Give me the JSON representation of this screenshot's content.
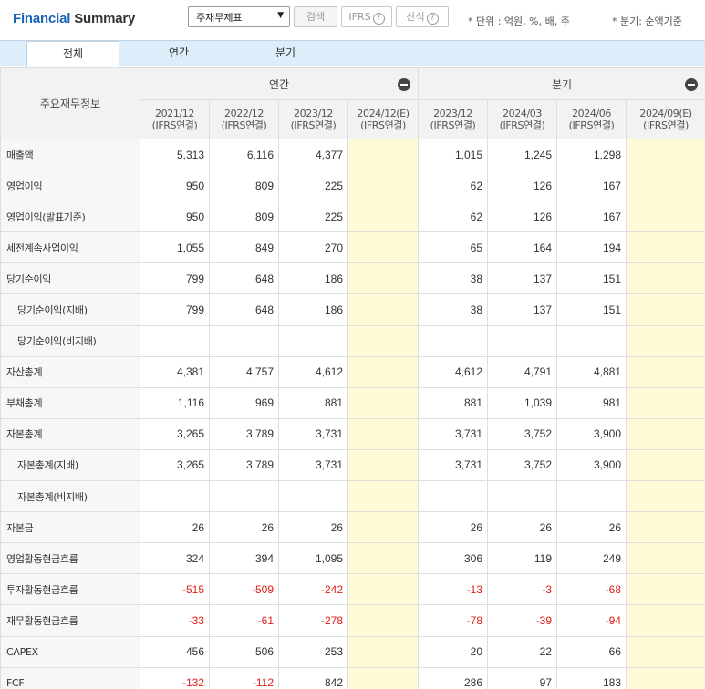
{
  "header": {
    "title_prefix": "Financial",
    "title_suffix": "Summary",
    "select_value": "주재무제표",
    "search_label": "검색",
    "ifrs_label": "IFRS",
    "calc_label": "산식",
    "help_glyph": "?",
    "unit_note": "* 단위 : 억원, %, 배, 주",
    "period_note": "* 분기: 순액기준"
  },
  "tabs": [
    "전체",
    "연간",
    "분기"
  ],
  "table": {
    "corner_label": "주요재무정보",
    "group_annual": "연간",
    "group_quarter": "분기",
    "columns": [
      {
        "date": "2021/12",
        "basis": "(IFRS연결)"
      },
      {
        "date": "2022/12",
        "basis": "(IFRS연결)"
      },
      {
        "date": "2023/12",
        "basis": "(IFRS연결)"
      },
      {
        "date": "2024/12(E)",
        "basis": "(IFRS연결)"
      },
      {
        "date": "2023/12",
        "basis": "(IFRS연결)"
      },
      {
        "date": "2024/03",
        "basis": "(IFRS연결)"
      },
      {
        "date": "2024/06",
        "basis": "(IFRS연결)"
      },
      {
        "date": "2024/09(E)",
        "basis": "(IFRS연결)"
      }
    ],
    "rows": [
      {
        "label": "매출액",
        "sub": false,
        "values": [
          "5,313",
          "6,116",
          "4,377",
          "",
          "1,015",
          "1,245",
          "1,298",
          ""
        ]
      },
      {
        "label": "영업이익",
        "sub": false,
        "values": [
          "950",
          "809",
          "225",
          "",
          "62",
          "126",
          "167",
          ""
        ]
      },
      {
        "label": "영업이익(발표기준)",
        "sub": false,
        "values": [
          "950",
          "809",
          "225",
          "",
          "62",
          "126",
          "167",
          ""
        ]
      },
      {
        "label": "세전계속사업이익",
        "sub": false,
        "values": [
          "1,055",
          "849",
          "270",
          "",
          "65",
          "164",
          "194",
          ""
        ]
      },
      {
        "label": "당기순이익",
        "sub": false,
        "values": [
          "799",
          "648",
          "186",
          "",
          "38",
          "137",
          "151",
          ""
        ]
      },
      {
        "label": "당기순이익(지배)",
        "sub": true,
        "values": [
          "799",
          "648",
          "186",
          "",
          "38",
          "137",
          "151",
          ""
        ]
      },
      {
        "label": "당기순이익(비지배)",
        "sub": true,
        "values": [
          "",
          "",
          "",
          "",
          "",
          "",
          "",
          ""
        ]
      },
      {
        "label": "자산총계",
        "sub": false,
        "values": [
          "4,381",
          "4,757",
          "4,612",
          "",
          "4,612",
          "4,791",
          "4,881",
          ""
        ]
      },
      {
        "label": "부채총계",
        "sub": false,
        "values": [
          "1,116",
          "969",
          "881",
          "",
          "881",
          "1,039",
          "981",
          ""
        ]
      },
      {
        "label": "자본총계",
        "sub": false,
        "values": [
          "3,265",
          "3,789",
          "3,731",
          "",
          "3,731",
          "3,752",
          "3,900",
          ""
        ]
      },
      {
        "label": "자본총계(지배)",
        "sub": true,
        "values": [
          "3,265",
          "3,789",
          "3,731",
          "",
          "3,731",
          "3,752",
          "3,900",
          ""
        ]
      },
      {
        "label": "자본총계(비지배)",
        "sub": true,
        "values": [
          "",
          "",
          "",
          "",
          "",
          "",
          "",
          ""
        ]
      },
      {
        "label": "자본금",
        "sub": false,
        "values": [
          "26",
          "26",
          "26",
          "",
          "26",
          "26",
          "26",
          ""
        ]
      },
      {
        "label": "영업활동현금흐름",
        "sub": false,
        "values": [
          "324",
          "394",
          "1,095",
          "",
          "306",
          "119",
          "249",
          ""
        ]
      },
      {
        "label": "투자활동현금흐름",
        "sub": false,
        "values": [
          "-515",
          "-509",
          "-242",
          "",
          "-13",
          "-3",
          "-68",
          ""
        ]
      },
      {
        "label": "재무활동현금흐름",
        "sub": false,
        "values": [
          "-33",
          "-61",
          "-278",
          "",
          "-78",
          "-39",
          "-94",
          ""
        ]
      },
      {
        "label": "CAPEX",
        "sub": false,
        "values": [
          "456",
          "506",
          "253",
          "",
          "20",
          "22",
          "66",
          ""
        ]
      },
      {
        "label": "FCF",
        "sub": false,
        "values": [
          "-132",
          "-112",
          "842",
          "",
          "286",
          "97",
          "183",
          ""
        ]
      }
    ]
  },
  "colors": {
    "accent": "#1a64b8",
    "negative": "#e0201b",
    "estimate_bg": "#fffbd9",
    "tab_bar": "#dceefa"
  }
}
